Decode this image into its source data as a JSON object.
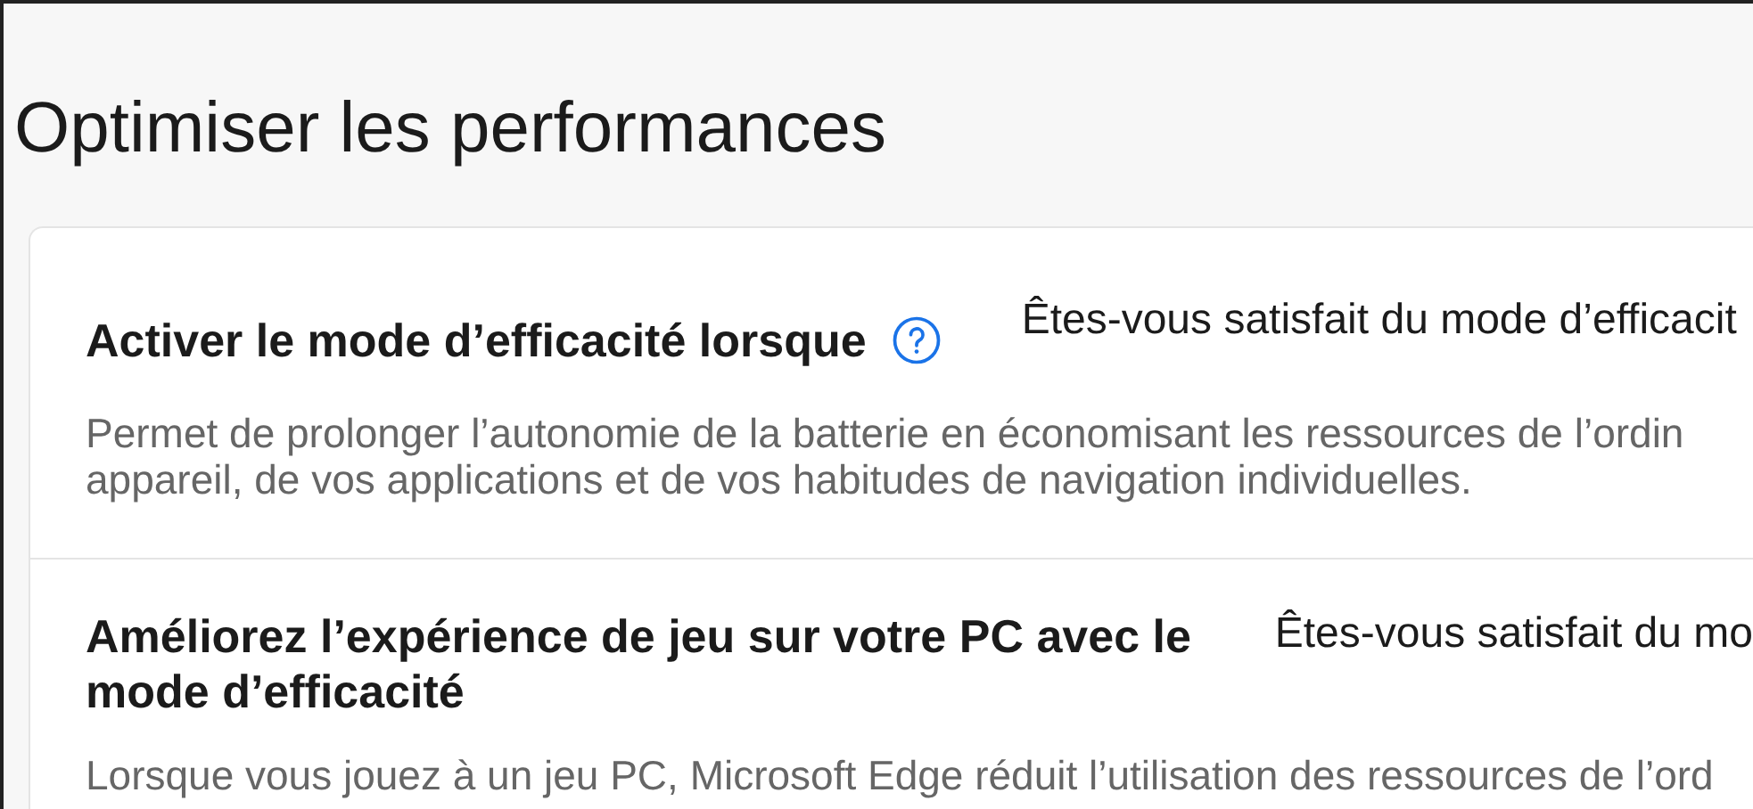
{
  "title": "Optimiser les performances",
  "sections": [
    {
      "heading": "Activer le mode d’efficacité lorsque",
      "help_icon": true,
      "feedback": "Êtes-vous satisfait du mode d’efficacit",
      "description": [
        "Permet de prolonger l’autonomie de la batterie en économisant les ressources de l’ordin",
        "appareil, de vos applications et de vos habitudes de navigation individuelles."
      ]
    },
    {
      "heading": "Améliorez l’expérience de jeu sur votre PC avec le mode d’efficacité",
      "help_icon": false,
      "feedback": "Êtes-vous satisfait du mo",
      "description": [
        "Lorsque vous jouez à un jeu PC, Microsoft Edge réduit l’utilisation des ressources de l’ord"
      ]
    }
  ]
}
